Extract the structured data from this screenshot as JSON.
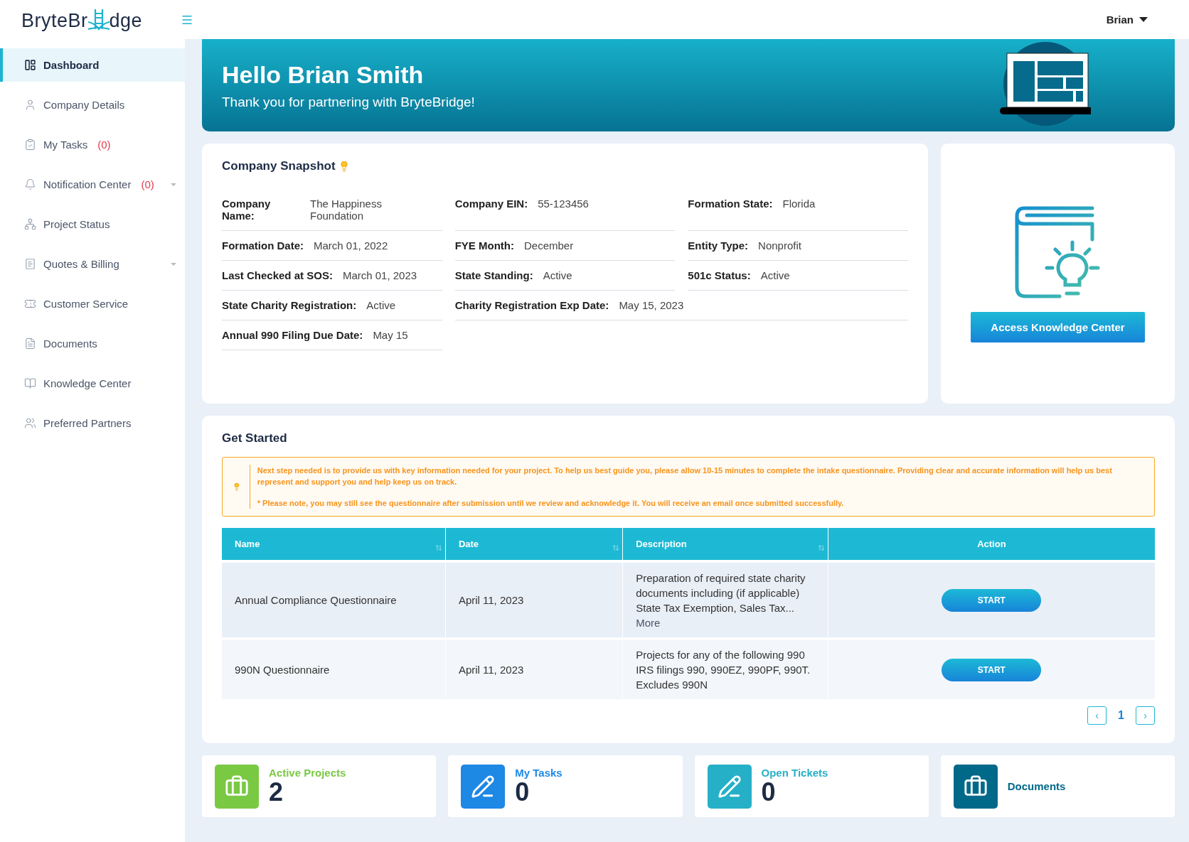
{
  "logo": {
    "before": "BryteBr",
    "after": "dge"
  },
  "user": {
    "name": "Brian"
  },
  "sidebar": {
    "items": [
      {
        "kind": "dashboard",
        "label": "Dashboard",
        "selected": true,
        "expandable": false
      },
      {
        "kind": "user",
        "label": "Company Details",
        "selected": false,
        "expandable": false
      },
      {
        "kind": "tasks",
        "label": "My Tasks",
        "count": "(0)",
        "selected": false,
        "expandable": false
      },
      {
        "kind": "bell",
        "label": "Notification Center",
        "count": "(0)",
        "selected": false,
        "expandable": true
      },
      {
        "kind": "status",
        "label": "Project Status",
        "selected": false,
        "expandable": false
      },
      {
        "kind": "billing",
        "label": "Quotes & Billing",
        "selected": false,
        "expandable": true
      },
      {
        "kind": "ticket",
        "label": "Customer Service",
        "selected": false,
        "expandable": false
      },
      {
        "kind": "document",
        "label": "Documents",
        "selected": false,
        "expandable": false
      },
      {
        "kind": "book",
        "label": "Knowledge Center",
        "selected": false,
        "expandable": false
      },
      {
        "kind": "partners",
        "label": "Preferred Partners",
        "selected": false,
        "expandable": false
      }
    ]
  },
  "banner": {
    "title": "Hello Brian Smith",
    "subtitle": "Thank you for partnering with BryteBridge!"
  },
  "snapshot": {
    "title": "Company Snapshot",
    "fields": [
      {
        "label": "Company Name:",
        "value": "The Happiness Foundation",
        "wide": false
      },
      {
        "label": "Company EIN:",
        "value": "55-123456",
        "wide": false
      },
      {
        "label": "Formation State:",
        "value": "Florida",
        "wide": false
      },
      {
        "label": "Formation Date:",
        "value": "March 01, 2022",
        "wide": false
      },
      {
        "label": "FYE Month:",
        "value": "December",
        "wide": false
      },
      {
        "label": "Entity Type:",
        "value": "Nonprofit",
        "wide": false
      },
      {
        "label": "Last Checked at SOS:",
        "value": "March 01, 2023",
        "wide": false
      },
      {
        "label": "State Standing:",
        "value": "Active",
        "wide": false
      },
      {
        "label": "501c Status:",
        "value": "Active",
        "wide": false
      },
      {
        "label": "State Charity Registration:",
        "value": "Active",
        "wide": false
      },
      {
        "label": "Charity Registration Exp Date:",
        "value": "May 15, 2023",
        "wide": true
      },
      {
        "label": "Annual 990 Filing Due Date:",
        "value": "May 15",
        "wide": false
      }
    ]
  },
  "knowledge": {
    "button": "Access Knowledge Center"
  },
  "get_started": {
    "title": "Get Started",
    "notice": [
      "Next step needed is to provide us with key information needed for your project. To help us best guide you, please allow 10-15 minutes to complete the intake questionnaire. Providing clear and accurate information will help us best represent and support you and help keep us on track.",
      "* Please note, you may still see the questionnaire after submission until we review and acknowledge it. You will receive an email once submitted successfully."
    ],
    "table": {
      "columns": [
        {
          "label": "Name",
          "sortable": true
        },
        {
          "label": "Date",
          "sortable": true
        },
        {
          "label": "Description",
          "sortable": true
        },
        {
          "label": "Action",
          "sortable": false
        }
      ],
      "rows": [
        {
          "name": "Annual Compliance Questionnaire",
          "date": "April 11, 2023",
          "description": "Preparation of required state charity documents including (if applicable) State Tax Exemption, Sales Tax...",
          "more": "More",
          "action": "START"
        },
        {
          "name": "990N Questionnaire",
          "date": "April 11, 2023",
          "description": "Projects for any of the following 990 IRS filings 990, 990EZ, 990PF, 990T. Excludes 990N",
          "action": "START"
        }
      ]
    },
    "pagination": {
      "prev": "‹",
      "pages": [
        {
          "label": "1",
          "selected": true
        }
      ],
      "next": "›"
    }
  },
  "stats": [
    {
      "kind": "projects",
      "label": "Active Projects",
      "value": "2",
      "color": "#7ac943"
    },
    {
      "kind": "tasks",
      "label": "My Tasks",
      "value": "0",
      "color": "#1e88e5"
    },
    {
      "kind": "tickets",
      "label": "Open Tickets",
      "value": "0",
      "color": "#26b0c8"
    },
    {
      "kind": "documents",
      "label": "Documents",
      "color": "#00698a"
    }
  ]
}
